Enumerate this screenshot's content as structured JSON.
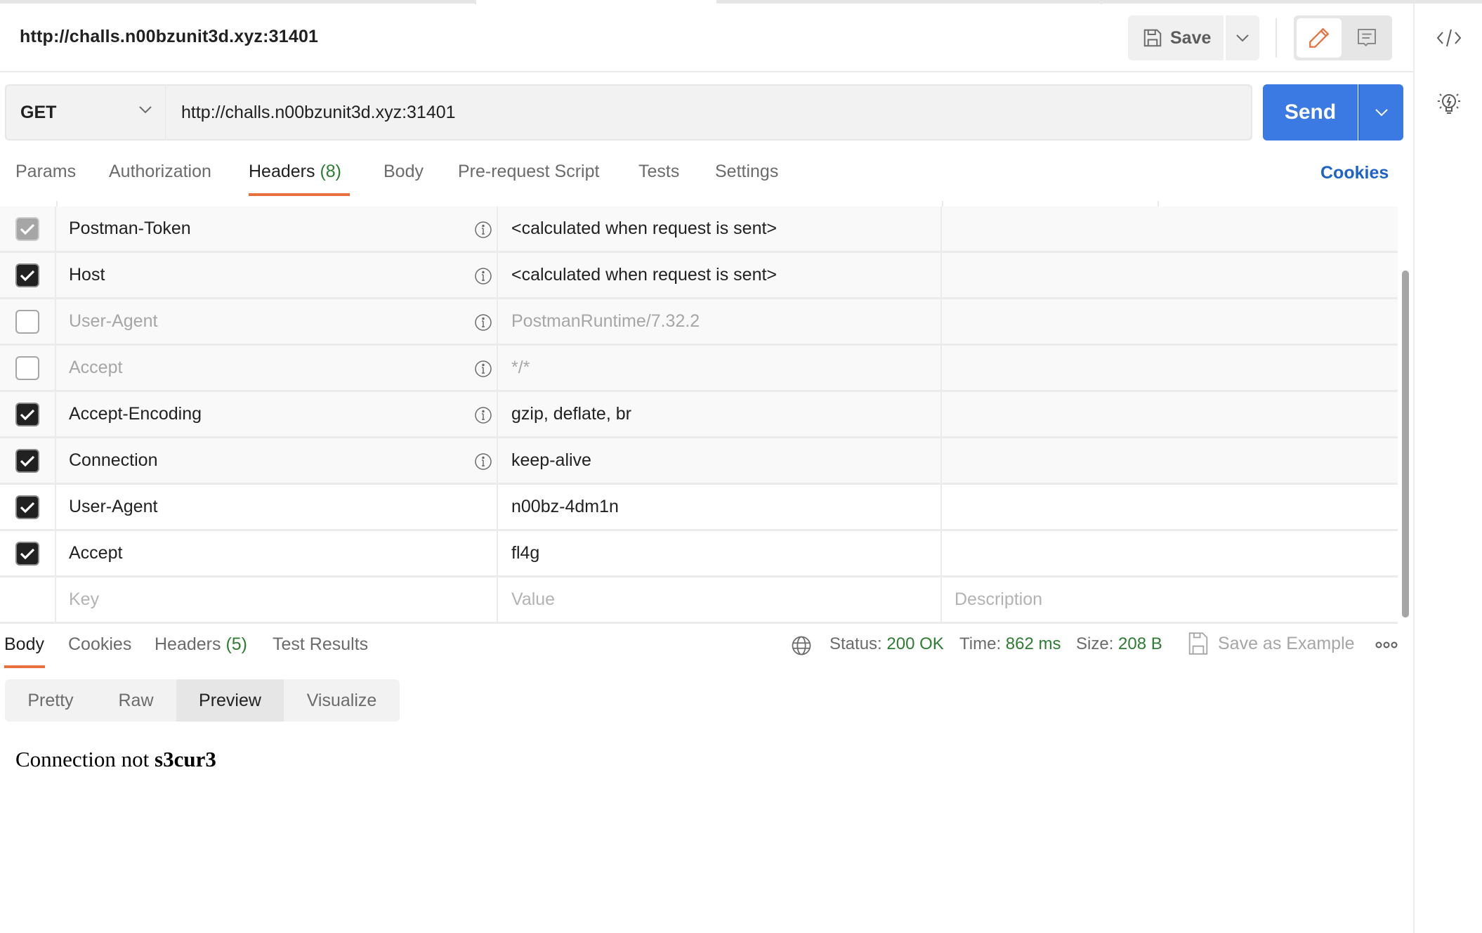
{
  "header": {
    "request_title": "http://challs.n00bzunit3d.xyz:31401",
    "save_label": "Save",
    "icons": {
      "save": "floppy-disk-icon",
      "save_menu": "chevron-down-icon",
      "edit_mode": "pencil-icon",
      "comment_mode": "comment-icon",
      "code": "code-icon",
      "suggest": "lightbulb-icon"
    }
  },
  "request": {
    "method": "GET",
    "url": "http://challs.n00bzunit3d.xyz:31401",
    "send_label": "Send"
  },
  "request_tabs": [
    {
      "label": "Params",
      "count": null,
      "active": false
    },
    {
      "label": "Authorization",
      "count": null,
      "active": false
    },
    {
      "label": "Headers",
      "count": "(8)",
      "active": true
    },
    {
      "label": "Body",
      "count": null,
      "active": false
    },
    {
      "label": "Pre-request Script",
      "count": null,
      "active": false
    },
    {
      "label": "Tests",
      "count": null,
      "active": false
    },
    {
      "label": "Settings",
      "count": null,
      "active": false
    }
  ],
  "cookies_link": "Cookies",
  "headers_table": {
    "rows": [
      {
        "checked": "auto",
        "key": "Postman-Token",
        "value": "<calculated when request is sent>",
        "description": "",
        "info": true,
        "enabled": true,
        "auto": true
      },
      {
        "checked": "on",
        "key": "Host",
        "value": "<calculated when request is sent>",
        "description": "",
        "info": true,
        "enabled": true,
        "auto": true
      },
      {
        "checked": "off",
        "key": "User-Agent",
        "value": "PostmanRuntime/7.32.2",
        "description": "",
        "info": true,
        "enabled": false,
        "auto": true
      },
      {
        "checked": "off",
        "key": "Accept",
        "value": "*/*",
        "description": "",
        "info": true,
        "enabled": false,
        "auto": true
      },
      {
        "checked": "on",
        "key": "Accept-Encoding",
        "value": "gzip, deflate, br",
        "description": "",
        "info": true,
        "enabled": true,
        "auto": true
      },
      {
        "checked": "on",
        "key": "Connection",
        "value": "keep-alive",
        "description": "",
        "info": true,
        "enabled": true,
        "auto": true
      },
      {
        "checked": "on",
        "key": "User-Agent",
        "value": "n00bz-4dm1n",
        "description": "",
        "info": false,
        "enabled": true,
        "auto": false
      },
      {
        "checked": "on",
        "key": "Accept",
        "value": "fl4g",
        "description": "",
        "info": false,
        "enabled": true,
        "auto": false
      }
    ],
    "new_row_placeholders": {
      "key": "Key",
      "value": "Value",
      "description": "Description"
    }
  },
  "response": {
    "tabs": [
      {
        "label": "Body",
        "count": null,
        "active": true
      },
      {
        "label": "Cookies",
        "count": null,
        "active": false
      },
      {
        "label": "Headers",
        "count": "(5)",
        "active": false
      },
      {
        "label": "Test Results",
        "count": null,
        "active": false
      }
    ],
    "status_label": "Status:",
    "status_value": "200 OK",
    "time_label": "Time:",
    "time_value": "862 ms",
    "size_label": "Size:",
    "size_value": "208 B",
    "save_example_label": "Save as Example",
    "view_modes": [
      {
        "label": "Pretty",
        "active": false
      },
      {
        "label": "Raw",
        "active": false
      },
      {
        "label": "Preview",
        "active": true
      },
      {
        "label": "Visualize",
        "active": false
      }
    ],
    "preview": {
      "text": "Connection not ",
      "bold": "s3cur3"
    }
  },
  "colors": {
    "accent_orange": "#e8703d",
    "send_blue": "#3a7ae2",
    "link_blue": "#1d63c8",
    "success_green": "#2e7d32"
  }
}
